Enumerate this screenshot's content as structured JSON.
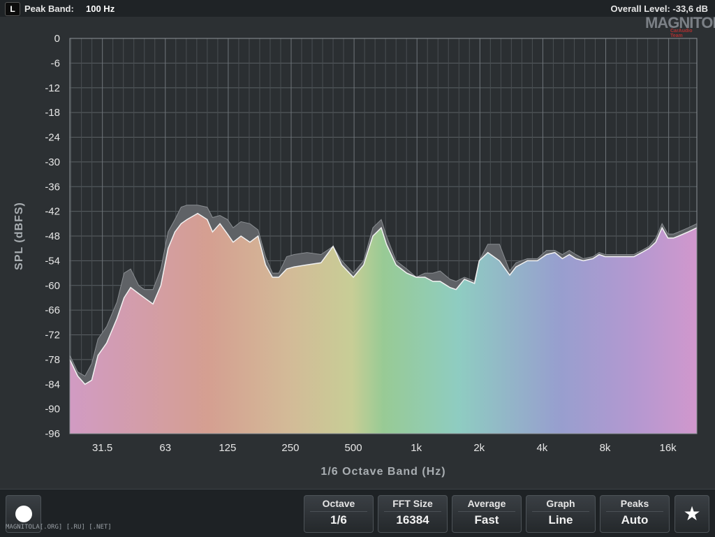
{
  "header": {
    "channel": "L",
    "peak_band_label": "Peak Band:",
    "peak_band_value": "100 Hz",
    "overall_level": "Overall Level:  -33,6 dB"
  },
  "logo": {
    "text": "MAGNITOLA",
    "subtext": "CarAudio Team"
  },
  "chart_data": {
    "type": "area",
    "xlabel": "1/6 Octave Band (Hz)",
    "ylabel": "SPL (dBFS)",
    "ylim": [
      -96,
      0
    ],
    "y_ticks": [
      0,
      -6,
      -12,
      -18,
      -24,
      -30,
      -36,
      -42,
      -48,
      -54,
      -60,
      -66,
      -72,
      -78,
      -84,
      -90,
      -96
    ],
    "x_tick_labels": [
      "31.5",
      "63",
      "125",
      "250",
      "500",
      "1k",
      "2k",
      "4k",
      "8k",
      "16k"
    ],
    "x_tick_freqs": [
      31.5,
      63,
      125,
      250,
      500,
      1000,
      2000,
      4000,
      8000,
      16000
    ],
    "xlim_hz": [
      22,
      22000
    ],
    "x_scale": "log",
    "grid": true,
    "series": [
      {
        "role": "current",
        "x": [
          22,
          24,
          26,
          28,
          30,
          33,
          37,
          40,
          43,
          47,
          50,
          55,
          60,
          65,
          70,
          75,
          80,
          90,
          100,
          106,
          115,
          125,
          133,
          145,
          160,
          175,
          190,
          205,
          220,
          240,
          260,
          300,
          350,
          400,
          440,
          500,
          560,
          620,
          680,
          720,
          800,
          900,
          1000,
          1100,
          1200,
          1300,
          1450,
          1550,
          1700,
          1800,
          1900,
          2000,
          2200,
          2500,
          2800,
          3000,
          3400,
          3800,
          4200,
          4600,
          5000,
          5400,
          5800,
          6300,
          7000,
          7500,
          8000,
          8500,
          9000,
          10000,
          11000,
          12000,
          13000,
          14000,
          15000,
          16000,
          17000,
          18000,
          20000,
          22000
        ],
        "y": [
          -78,
          -82,
          -84,
          -83,
          -77,
          -74,
          -68,
          -63,
          -60.5,
          -62,
          -63,
          -64.5,
          -60,
          -51,
          -47,
          -45,
          -44,
          -42.5,
          -44,
          -47,
          -45,
          -47.5,
          -49.5,
          -48,
          -49.5,
          -48,
          -55,
          -58,
          -58,
          -56,
          -55.5,
          -55,
          -54.5,
          -50.5,
          -55,
          -58,
          -55,
          -48,
          -46,
          -50,
          -55,
          -57,
          -58,
          -58,
          -59,
          -59,
          -60.5,
          -61,
          -58.5,
          -59,
          -59.5,
          -54,
          -52,
          -54,
          -57.5,
          -55.5,
          -54,
          -54,
          -52.5,
          -52,
          -53.5,
          -52.5,
          -53.5,
          -54,
          -53.5,
          -52.5,
          -53,
          -53,
          -53,
          -53,
          -53,
          -52,
          -51,
          -49.5,
          -46,
          -48.5,
          -48.5,
          -48,
          -47,
          -46
        ]
      },
      {
        "role": "peak-hold",
        "x": [
          22,
          24,
          26,
          28,
          30,
          33,
          37,
          40,
          43,
          47,
          50,
          55,
          60,
          65,
          70,
          75,
          80,
          90,
          100,
          106,
          115,
          125,
          133,
          145,
          160,
          175,
          190,
          205,
          220,
          240,
          260,
          300,
          350,
          400,
          440,
          500,
          560,
          620,
          680,
          720,
          800,
          900,
          1000,
          1100,
          1200,
          1300,
          1450,
          1550,
          1700,
          1800,
          1900,
          2000,
          2200,
          2500,
          2800,
          3000,
          3400,
          3800,
          4200,
          4600,
          5000,
          5400,
          5800,
          6300,
          7000,
          7500,
          8000,
          8500,
          9000,
          10000,
          11000,
          12000,
          13000,
          14000,
          15000,
          16000,
          17000,
          18000,
          20000,
          22000
        ],
        "y": [
          -77,
          -81,
          -82,
          -79,
          -73,
          -70,
          -64,
          -57,
          -56,
          -60,
          -61,
          -61,
          -56,
          -47,
          -44,
          -41,
          -40.5,
          -40.5,
          -41,
          -43.5,
          -43,
          -44,
          -46,
          -44.5,
          -45,
          -46.5,
          -53,
          -57,
          -57,
          -53,
          -52.5,
          -52,
          -52.5,
          -50.5,
          -54,
          -57,
          -54,
          -46,
          -44,
          -48,
          -54,
          -56,
          -58,
          -57,
          -57,
          -56.5,
          -58.5,
          -59,
          -58,
          -58.5,
          -59,
          -54,
          -50,
          -50,
          -56.5,
          -54.5,
          -53.5,
          -53.5,
          -51.5,
          -51.5,
          -52.5,
          -51.5,
          -52.5,
          -53.5,
          -53,
          -52,
          -52.5,
          -52.5,
          -52.5,
          -52.5,
          -52.5,
          -51.5,
          -50.5,
          -48.5,
          -45,
          -47.5,
          -47.5,
          -47,
          -46,
          -45
        ]
      }
    ]
  },
  "controls": {
    "octave": {
      "label": "Octave",
      "value": "1/6"
    },
    "fft_size": {
      "label": "FFT Size",
      "value": "16384"
    },
    "average": {
      "label": "Average",
      "value": "Fast"
    },
    "graph": {
      "label": "Graph",
      "value": "Line"
    },
    "peaks": {
      "label": "Peaks",
      "value": "Auto"
    }
  },
  "colors": {
    "background": "#2c3033",
    "plot_background": "#2b2f32",
    "grid": "#5b6064",
    "peak_fill": "#5f6266",
    "spectrum_start": "#d79ec8",
    "spectrum_mid": "#9ad296",
    "spectrum_end": "#d49bd6"
  },
  "watermark": "MAGNITOLA[.ORG] [.RU] [.NET]"
}
